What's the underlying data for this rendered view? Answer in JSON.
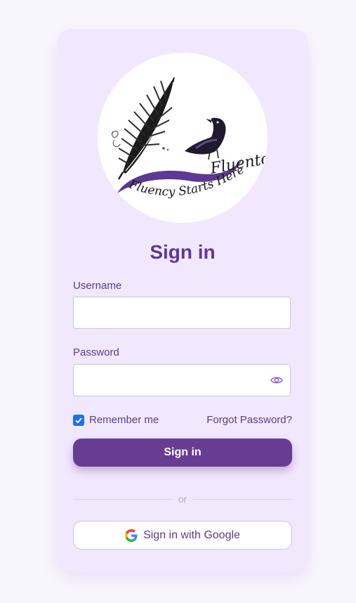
{
  "logo": {
    "wordmark": "Fluento",
    "tagline": "Fluency Starts Here"
  },
  "form": {
    "title": "Sign in",
    "username_label": "Username",
    "username_value": "",
    "password_label": "Password",
    "password_value": "",
    "remember_label": "Remember me",
    "remember_checked": true,
    "forgot_label": "Forgot Password?",
    "submit_label": "Sign in",
    "divider_text": "or",
    "google_label": "Sign in with Google"
  },
  "icons": {
    "password_toggle": "eye-icon",
    "google": "google-icon",
    "checkbox": "checkmark-icon"
  },
  "colors": {
    "page_background": "#f8f6fd",
    "card_background": "#f2e8fe",
    "primary": "#663d93",
    "title": "#5e3893",
    "text": "#5a3d86",
    "checkbox": "#1a73e8"
  }
}
